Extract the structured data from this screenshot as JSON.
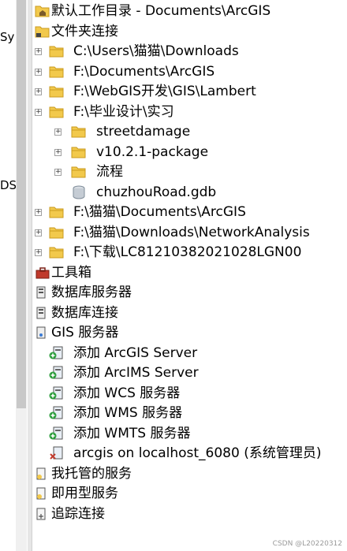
{
  "left_pane": {
    "fragment_top": "Sy",
    "fragment_mid": "DS"
  },
  "tree": {
    "items": [
      {
        "label": "默认工作目录 - Documents\\ArcGIS",
        "icon": "home-folder-icon"
      },
      {
        "label": "文件夹连接",
        "icon": "folder-connections-icon"
      },
      {
        "label": "C:\\Users\\猫猫\\Downloads",
        "icon": "folder-icon"
      },
      {
        "label": "F:\\Documents\\ArcGIS",
        "icon": "folder-icon"
      },
      {
        "label": "F:\\WebGIS开发\\GIS\\Lambert",
        "icon": "folder-icon"
      },
      {
        "label": "F:\\毕业设计\\实习",
        "icon": "folder-icon"
      },
      {
        "label": "streetdamage",
        "icon": "folder-icon"
      },
      {
        "label": "v10.2.1-package",
        "icon": "folder-icon"
      },
      {
        "label": "流程",
        "icon": "folder-icon"
      },
      {
        "label": "chuzhouRoad.gdb",
        "icon": "geodatabase-icon"
      },
      {
        "label": "F:\\猫猫\\Documents\\ArcGIS",
        "icon": "folder-icon"
      },
      {
        "label": "F:\\猫猫\\Downloads\\NetworkAnalysis",
        "icon": "folder-icon"
      },
      {
        "label": "F:\\下载\\LC81210382021028LGN00",
        "icon": "folder-icon"
      },
      {
        "label": "工具箱",
        "icon": "toolbox-icon"
      },
      {
        "label": "数据库服务器",
        "icon": "database-server-icon"
      },
      {
        "label": "数据库连接",
        "icon": "database-connection-icon"
      },
      {
        "label": "GIS 服务器",
        "icon": "gis-server-icon"
      },
      {
        "label": "添加 ArcGIS Server",
        "icon": "add-server-icon"
      },
      {
        "label": "添加 ArcIMS Server",
        "icon": "add-server-icon"
      },
      {
        "label": "添加 WCS 服务器",
        "icon": "add-server-icon"
      },
      {
        "label": "添加 WMS 服务器",
        "icon": "add-server-icon"
      },
      {
        "label": "添加 WMTS 服务器",
        "icon": "add-server-icon"
      },
      {
        "label": "arcgis on localhost_6080 (系统管理员)",
        "icon": "server-connection-icon"
      },
      {
        "label": "我托管的服务",
        "icon": "hosted-services-icon"
      },
      {
        "label": "即用型服务",
        "icon": "ready-services-icon"
      },
      {
        "label": "追踪连接",
        "icon": "tracking-connection-icon"
      }
    ]
  },
  "watermark": "CSDN @L20220312",
  "colors": {
    "folder": "#f2c94c",
    "folder_dark": "#c99a1e",
    "server": "#3a7bd5",
    "red": "#c0392b"
  }
}
